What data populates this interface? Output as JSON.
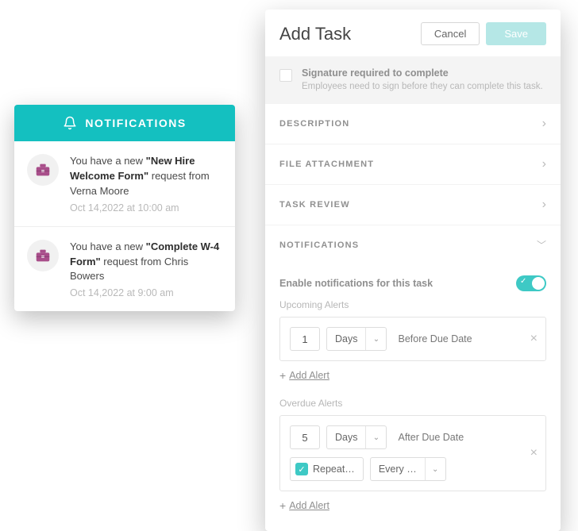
{
  "notifications_card": {
    "title": "NOTIFICATIONS",
    "items": [
      {
        "prefix": "You have a new ",
        "bold": "\"New Hire Welcome Form\"",
        "suffix": " request from Verna Moore",
        "timestamp": "Oct 14,2022 at 10:00 am"
      },
      {
        "prefix": "You have a new ",
        "bold": "\"Complete W-4 Form\"",
        "suffix": " request from Chris Bowers",
        "timestamp": "Oct 14,2022 at 9:00 am"
      }
    ]
  },
  "task_panel": {
    "title": "Add Task",
    "cancel_label": "Cancel",
    "save_label": "Save",
    "signature": {
      "label": "Signature required to complete",
      "desc": "Employees need to sign before they can complete this task."
    },
    "sections": {
      "description": "DESCRIPTION",
      "file_attachment": "FILE ATTACHMENT",
      "task_review": "TASK REVIEW",
      "notifications": "NOTIFICATIONS"
    },
    "enable_label": "Enable notifications for this task",
    "upcoming_heading": "Upcoming Alerts",
    "upcoming": {
      "value": "1",
      "unit": "Days",
      "relation": "Before Due Date"
    },
    "overdue_heading": "Overdue Alerts",
    "overdue": {
      "value": "5",
      "unit": "Days",
      "relation": "After Due Date",
      "repeat_label": "Repeat…",
      "every_label": "Every …"
    },
    "add_alert_label": "Add Alert"
  }
}
